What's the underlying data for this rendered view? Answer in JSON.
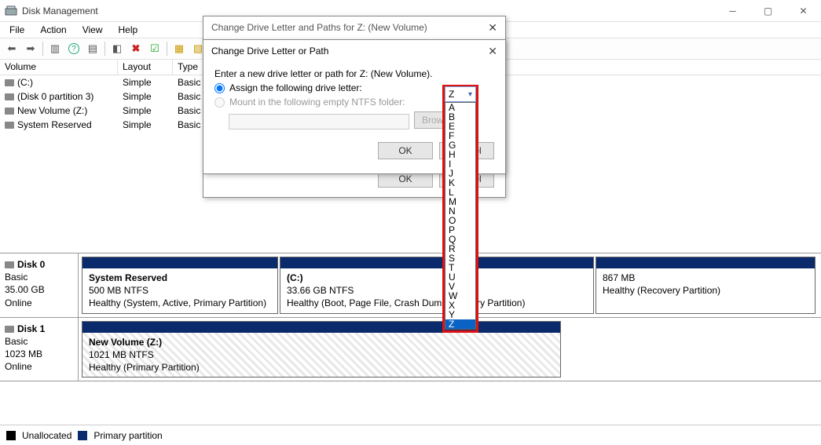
{
  "window": {
    "title": "Disk Management"
  },
  "menu": {
    "file": "File",
    "action": "Action",
    "view": "View",
    "help": "Help"
  },
  "list": {
    "headers": {
      "volume": "Volume",
      "layout": "Layout",
      "type": "Type"
    },
    "rows": [
      {
        "vol": "(C:)",
        "lay": "Simple",
        "typ": "Basic"
      },
      {
        "vol": "(Disk 0 partition 3)",
        "lay": "Simple",
        "typ": "Basic"
      },
      {
        "vol": "New Volume (Z:)",
        "lay": "Simple",
        "typ": "Basic"
      },
      {
        "vol": "System Reserved",
        "lay": "Simple",
        "typ": "Basic"
      }
    ]
  },
  "disks": [
    {
      "name": "Disk 0",
      "type": "Basic",
      "size": "35.00 GB",
      "status": "Online",
      "parts": [
        {
          "title": "System Reserved",
          "sub": "500 MB NTFS",
          "health": "Healthy (System, Active, Primary Partition)"
        },
        {
          "title": "(C:)",
          "sub": "33.66 GB NTFS",
          "health": "Healthy (Boot, Page File, Crash Dump, Primary Partition)"
        },
        {
          "title": "",
          "sub": "867 MB",
          "health": "Healthy (Recovery Partition)"
        }
      ]
    },
    {
      "name": "Disk 1",
      "type": "Basic",
      "size": "1023 MB",
      "status": "Online",
      "parts": [
        {
          "title": "New Volume  (Z:)",
          "sub": "1021 MB NTFS",
          "health": "Healthy (Primary Partition)"
        }
      ]
    }
  ],
  "legend": {
    "unalloc": "Unallocated",
    "primary": "Primary partition"
  },
  "outer_dialog": {
    "title": "Change Drive Letter and Paths for Z: (New Volume)",
    "ok": "OK",
    "cancel": "Cancel"
  },
  "inner_dialog": {
    "title": "Change Drive Letter or Path",
    "instruction": "Enter a new drive letter or path for Z: (New Volume).",
    "opt_assign": "Assign the following drive letter:",
    "opt_mount": "Mount in the following empty NTFS folder:",
    "browse": "Browse...",
    "ok": "OK",
    "cancel": "Cancel",
    "selected": "Z",
    "letters": [
      "A",
      "B",
      "E",
      "F",
      "G",
      "H",
      "I",
      "J",
      "K",
      "L",
      "M",
      "N",
      "O",
      "P",
      "Q",
      "R",
      "S",
      "T",
      "U",
      "V",
      "W",
      "X",
      "Y",
      "Z"
    ]
  }
}
